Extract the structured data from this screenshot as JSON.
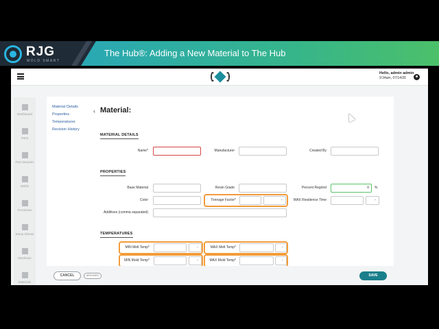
{
  "banner": {
    "logo_text": "RJG",
    "logo_tagline": "MOLD SMART",
    "title": "The Hub®: Adding a New Material to The Hub"
  },
  "topbar": {
    "greeting": "Hello, admin admin",
    "timestamp": "9:34am, 07/14/26"
  },
  "leftnav": {
    "items": [
      {
        "label": "Dashboard",
        "icon": "dashboard-icon"
      },
      {
        "label": "Parts",
        "icon": "cube-icon"
      },
      {
        "label": "Part Samples",
        "icon": "sample-icon"
      },
      {
        "label": "Molds",
        "icon": "mold-icon"
      },
      {
        "label": "Processes",
        "icon": "process-icon"
      },
      {
        "label": "Setup Sheets",
        "icon": "sheet-icon"
      },
      {
        "label": "Machines",
        "icon": "machine-icon"
      },
      {
        "label": "Materials",
        "icon": "materials-icon"
      }
    ]
  },
  "sidenav": {
    "links": [
      "Material Details",
      "Properties",
      "Temperatures",
      "Revision History"
    ]
  },
  "page": {
    "title": "Material:"
  },
  "sections": {
    "details": "MATERIAL DETAILS",
    "properties": "PROPERTIES",
    "temperatures": "TEMPERATURES"
  },
  "fields": {
    "name": "Name*",
    "manufacturer": "Manufacturer",
    "created_by": "Created By",
    "base_material": "Base Material",
    "resin_grade": "Resin Grade",
    "percent_regrind": "Percent Regrind",
    "percent_regrind_value": "0",
    "percent_sign": "%",
    "color": "Color",
    "tonnage_factor": "Tonnage Factor*",
    "max_residence_time": "MAX Residence Time",
    "additives": "Additives (comma separated)",
    "min_melt_temp": "MIN Melt Temp*",
    "max_melt_temp": "MAX Melt Temp*",
    "min_mold_temp": "MIN Mold Temp*",
    "max_mold_temp": "MAX Mold Temp*"
  },
  "footer": {
    "cancel": "CANCEL",
    "archived": "ARCHIVED",
    "save": "SAVE"
  },
  "colors": {
    "accent": "#1b7f8c",
    "highlight": "#f29b38",
    "error": "#d64545",
    "valid": "#5cc26b"
  }
}
